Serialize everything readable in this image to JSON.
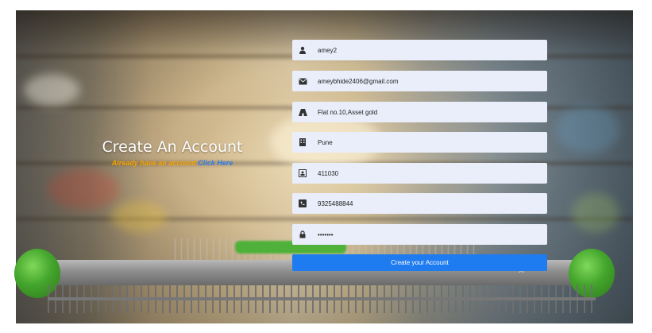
{
  "hero": {
    "title": "Create An Account",
    "subtitle": "Already have an account",
    "link": "Click Here"
  },
  "form": {
    "fields": [
      {
        "icon": "user-icon",
        "value": "amey2"
      },
      {
        "icon": "envelope-icon",
        "value": "ameybhide2406@gmail.com"
      },
      {
        "icon": "road-icon",
        "value": "Flat no.10,Asset gold"
      },
      {
        "icon": "building-icon",
        "value": "Pune"
      },
      {
        "icon": "id-card-icon",
        "value": "411030"
      },
      {
        "icon": "phone-icon",
        "value": "9325488844"
      },
      {
        "icon": "lock-icon",
        "value": "•••••••"
      }
    ],
    "submit_label": "Create your Account"
  },
  "colors": {
    "subtitle": "#f5a300",
    "link": "#2f7de8",
    "button": "#1e7bf0",
    "field_bg": "#e9eefa"
  }
}
